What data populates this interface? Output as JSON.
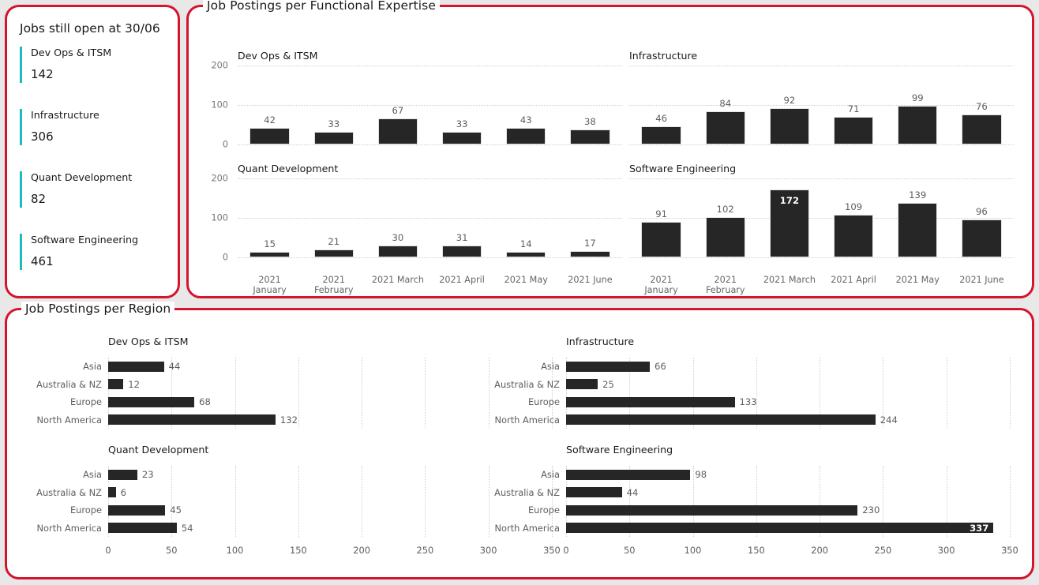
{
  "kpi_panel": {
    "title": "Jobs still open at 30/06",
    "accent_color": "#17BEBB",
    "items": [
      {
        "label": "Dev Ops & ITSM",
        "value": "142"
      },
      {
        "label": "Infrastructure",
        "value": "306"
      },
      {
        "label": "Quant Development",
        "value": "82"
      },
      {
        "label": "Software Engineering",
        "value": "461"
      }
    ]
  },
  "functional_panel": {
    "title": "Job Postings per Functional Expertise"
  },
  "region_panel": {
    "title": "Job Postings per Region"
  },
  "theme": {
    "border_color": "#D6142C",
    "bar_color": "#262626",
    "background": "#E8E8E8",
    "panel_background": "#FFFFFF"
  },
  "chart_data": [
    {
      "type": "bar",
      "title": "Dev Ops & ITSM",
      "panel": "Job Postings per Functional Expertise",
      "categories": [
        "2021 January",
        "2021 February",
        "2021 March",
        "2021 April",
        "2021 May",
        "2021 June"
      ],
      "values": [
        42,
        33,
        67,
        33,
        43,
        38
      ],
      "xlabel": "",
      "ylabel": "",
      "ylim": [
        0,
        200
      ],
      "yticks": [
        0,
        100,
        200
      ],
      "grid": true,
      "legend": "none"
    },
    {
      "type": "bar",
      "title": "Infrastructure",
      "panel": "Job Postings per Functional Expertise",
      "categories": [
        "2021 January",
        "2021 February",
        "2021 March",
        "2021 April",
        "2021 May",
        "2021 June"
      ],
      "values": [
        46,
        84,
        92,
        71,
        99,
        76
      ],
      "xlabel": "",
      "ylabel": "",
      "ylim": [
        0,
        200
      ],
      "yticks": [
        0,
        100,
        200
      ],
      "grid": true,
      "legend": "none"
    },
    {
      "type": "bar",
      "title": "Quant Development",
      "panel": "Job Postings per Functional Expertise",
      "categories": [
        "2021 January",
        "2021 February",
        "2021 March",
        "2021 April",
        "2021 May",
        "2021 June"
      ],
      "values": [
        15,
        21,
        30,
        31,
        14,
        17
      ],
      "xlabel": "",
      "ylabel": "",
      "ylim": [
        0,
        200
      ],
      "yticks": [
        0,
        100,
        200
      ],
      "grid": true,
      "legend": "none"
    },
    {
      "type": "bar",
      "title": "Software Engineering",
      "panel": "Job Postings per Functional Expertise",
      "categories": [
        "2021 January",
        "2021 February",
        "2021 March",
        "2021 April",
        "2021 May",
        "2021 June"
      ],
      "values": [
        91,
        102,
        172,
        109,
        139,
        96
      ],
      "xlabel": "",
      "ylabel": "",
      "ylim": [
        0,
        200
      ],
      "yticks": [
        0,
        100,
        200
      ],
      "grid": true,
      "legend": "none",
      "labels_inside": [
        172
      ]
    },
    {
      "type": "bar",
      "orientation": "horizontal",
      "title": "Dev Ops & ITSM",
      "panel": "Job Postings per Region",
      "categories": [
        "Asia",
        "Australia & NZ",
        "Europe",
        "North America"
      ],
      "values": [
        44,
        12,
        68,
        132
      ],
      "xlabel": "",
      "ylabel": "",
      "xlim": [
        0,
        360
      ],
      "xticks": [
        0,
        50,
        100,
        150,
        200,
        250,
        300,
        350
      ],
      "grid": true,
      "legend": "none"
    },
    {
      "type": "bar",
      "orientation": "horizontal",
      "title": "Infrastructure",
      "panel": "Job Postings per Region",
      "categories": [
        "Asia",
        "Australia & NZ",
        "Europe",
        "North America"
      ],
      "values": [
        66,
        25,
        133,
        244
      ],
      "xlabel": "",
      "ylabel": "",
      "xlim": [
        0,
        360
      ],
      "xticks": [
        0,
        50,
        100,
        150,
        200,
        250,
        300,
        350
      ],
      "grid": true,
      "legend": "none"
    },
    {
      "type": "bar",
      "orientation": "horizontal",
      "title": "Quant Development",
      "panel": "Job Postings per Region",
      "categories": [
        "Asia",
        "Australia & NZ",
        "Europe",
        "North America"
      ],
      "values": [
        23,
        6,
        45,
        54
      ],
      "xlabel": "",
      "ylabel": "",
      "xlim": [
        0,
        360
      ],
      "xticks": [
        0,
        50,
        100,
        150,
        200,
        250,
        300,
        350
      ],
      "grid": true,
      "legend": "none"
    },
    {
      "type": "bar",
      "orientation": "horizontal",
      "title": "Software Engineering",
      "panel": "Job Postings per Region",
      "categories": [
        "Asia",
        "Australia & NZ",
        "Europe",
        "North America"
      ],
      "values": [
        98,
        44,
        230,
        337
      ],
      "xlabel": "",
      "ylabel": "",
      "xlim": [
        0,
        360
      ],
      "xticks": [
        0,
        50,
        100,
        150,
        200,
        250,
        300,
        350
      ],
      "grid": true,
      "legend": "none",
      "labels_inside": [
        337
      ]
    }
  ]
}
